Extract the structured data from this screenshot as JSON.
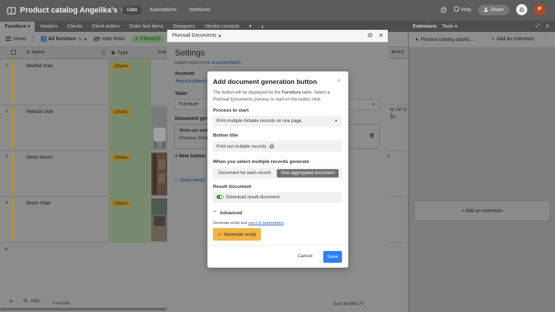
{
  "app": {
    "base_title": "Product catalog Angelika's",
    "nav": [
      "Data",
      "Automations",
      "Interfaces"
    ],
    "help": "Help",
    "share": "Share",
    "avatar_initial": "P"
  },
  "tabs": [
    "Furniture",
    "Vendors",
    "Clients",
    "Client orders",
    "Order line items",
    "Designers",
    "Vendor contacts"
  ],
  "viewbar": {
    "views": "Views",
    "view_name": "All furniture",
    "hide_fields": "Hide fields",
    "filtered": "Filtered b"
  },
  "grid": {
    "columns": {
      "name": "Name",
      "type": "Type",
      "image": "Ima"
    },
    "rows": [
      {
        "num": "1",
        "name": "Madrid chair",
        "type": "Chairs"
      },
      {
        "num": "2",
        "name": "Nebula chair",
        "type": "Chairs"
      },
      {
        "num": "3",
        "name": "Gedo bench",
        "type": "Chairs"
      },
      {
        "num": "4",
        "name": "Ikrore chair",
        "type": "Chairs"
      }
    ],
    "footer": {
      "add": "Add...",
      "count": "4 records",
      "sum": "Sum  $8,686.75"
    },
    "right_col_header": "W×H)",
    "right_texts": [
      "W 18\" D 1",
      "25\"",
      "8"
    ]
  },
  "extensions": {
    "tabs": [
      "Extensions",
      "Tools"
    ],
    "dashboard_title": "Product catalog dashb...",
    "add_extension": "Add an extension",
    "add_extension_box": "Add an extension"
  },
  "plumsail": {
    "window_title": "Plumsail Documents",
    "settings_heading": "Settings",
    "learn_prefix": "Learn more in ",
    "learn_link": "the documentation",
    "account_label": "Account",
    "account_value": "Jessica Adams",
    "table_label": "Table",
    "table_value": "Furniture",
    "docgen_label": "Document gene",
    "box_line1": "Print out multi",
    "box_line2": "Process: Print",
    "new_button": "New button",
    "show_templates": "Show templ"
  },
  "dialog": {
    "title": "Add document generation button",
    "desc_part1": "The button will be displayed for the ",
    "desc_table": "Furniture",
    "desc_part2": " table. Select a Plumsail Documents process to start on the button click.",
    "process_label": "Process to start",
    "process_value": "Print multiple Airtable records on one page",
    "button_title_label": "Button title",
    "button_title_value": "Print out multiple records",
    "multi_label": "When you select multiple records generate",
    "multi_opt1": "Document for each record",
    "multi_opt2": "One aggregated document",
    "result_label": "Result document",
    "result_value": "Download result document",
    "advanced": "Advanced",
    "adv_desc_prefix": "Generate script and ",
    "adv_desc_link": "use it in automations",
    "adv_desc_suffix": ".",
    "generate_script": "Generate script",
    "cancel": "Cancel",
    "save": "Save"
  }
}
